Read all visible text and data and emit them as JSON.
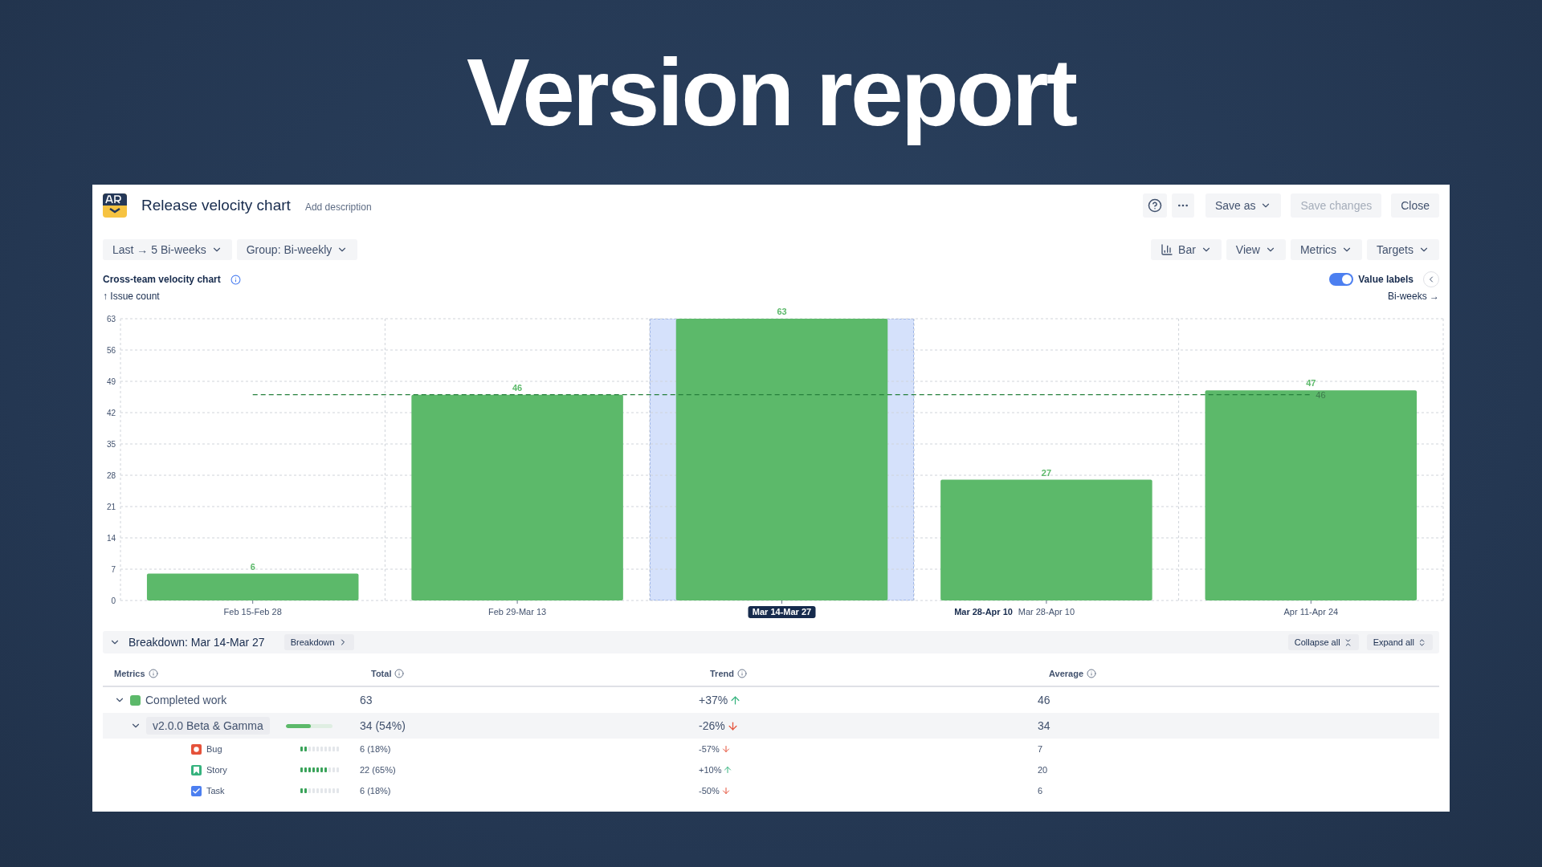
{
  "headline": "Version report",
  "report": {
    "title": "Release velocity chart",
    "description_link": "Add description",
    "actions": [
      {
        "label": "Save as",
        "dropdown": true,
        "disabled": false
      },
      {
        "label": "Save changes",
        "dropdown": false,
        "disabled": true
      },
      {
        "label": "Close",
        "dropdown": false,
        "disabled": false
      }
    ]
  },
  "filters": [
    {
      "label": "Last → 5 Bi-weeks"
    },
    {
      "label": "Group: Bi-weekly"
    }
  ],
  "view_controls": [
    {
      "label": "Bar",
      "kind": "chart-type"
    },
    {
      "label": "View",
      "kind": "menu"
    },
    {
      "label": "Metrics",
      "kind": "menu"
    },
    {
      "label": "Targets",
      "kind": "menu"
    }
  ],
  "chart": {
    "title": "Cross-team velocity chart",
    "value_labels": {
      "label": "Value labels",
      "on": true
    },
    "y_axis_label": "↑ Issue count",
    "x_axis_label": "Bi-weeks →",
    "category_states": [
      {
        "selected": false
      },
      {
        "selected": false
      },
      {
        "selected": true
      },
      {
        "selected": false,
        "hover_label": "Mar 28-Apr 10"
      },
      {
        "selected": false
      }
    ],
    "chart_data": {
      "type": "bar",
      "categories": [
        "Feb 15-Feb 28",
        "Feb 29-Mar 13",
        "Mar 14-Mar 27",
        "Mar 28-Apr 10",
        "Apr 11-Apr 24"
      ],
      "series": [
        {
          "color": "#5cb96a",
          "values": [
            6,
            46,
            63,
            27,
            47
          ]
        }
      ],
      "ylim": [
        0,
        63
      ],
      "yticks": [
        0,
        7,
        14,
        21,
        28,
        35,
        42,
        49,
        56,
        63
      ],
      "data_labels": true,
      "grid": true,
      "ref_lines": [
        {
          "axis": "y",
          "value": 46,
          "label": "46"
        }
      ]
    }
  },
  "breakdown": {
    "title": "Breakdown: Mar 14-Mar 27",
    "expanded": true,
    "button": "Breakdown",
    "collapse": "Collapse all",
    "expand": "Expand all"
  },
  "table": {
    "columns": [
      "Metrics",
      "Total",
      "Trend",
      "Average"
    ],
    "rows": [
      {
        "kind": "metric",
        "name": "Completed work",
        "color": "#5cb96a",
        "expanded": true,
        "total": "63",
        "trend": "+37%",
        "rising": true,
        "average": "46",
        "children": [
          {
            "kind": "version",
            "name": "v2.0.0 Beta & Gamma",
            "expanded": true,
            "level": 0.54,
            "total": "34 (54%)",
            "trend": "-26%",
            "rising": false,
            "average": "34",
            "children": [
              {
                "kind": "bug",
                "name": "Bug",
                "level": 0.18,
                "total": "6 (18%)",
                "trend": "-57%",
                "rising": false,
                "average": "7"
              },
              {
                "kind": "story",
                "name": "Story",
                "level": 0.65,
                "total": "22 (65%)",
                "trend": "+10%",
                "rising": true,
                "average": "20"
              },
              {
                "kind": "task",
                "name": "Task",
                "level": 0.18,
                "total": "6 (18%)",
                "trend": "-50%",
                "rising": false,
                "average": "6"
              }
            ]
          }
        ]
      }
    ]
  }
}
